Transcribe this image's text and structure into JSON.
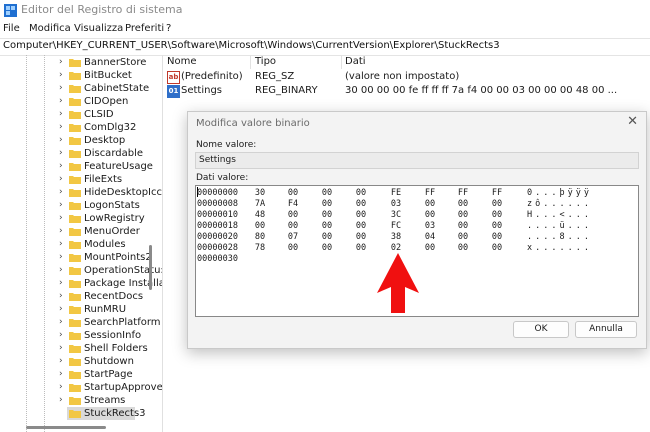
{
  "window": {
    "title": "Editor del Registro di sistema",
    "app_icon": "regedit-icon"
  },
  "menu": [
    "File",
    "Modifica",
    "Visualizza",
    "Preferiti",
    "?"
  ],
  "address": "Computer\\HKEY_CURRENT_USER\\Software\\Microsoft\\Windows\\CurrentVersion\\Explorer\\StuckRects3",
  "tree": {
    "items": [
      {
        "label": "BannerStore"
      },
      {
        "label": "BitBucket"
      },
      {
        "label": "CabinetState"
      },
      {
        "label": "CIDOpen"
      },
      {
        "label": "CLSID"
      },
      {
        "label": "ComDlg32"
      },
      {
        "label": "Desktop"
      },
      {
        "label": "Discardable"
      },
      {
        "label": "FeatureUsage"
      },
      {
        "label": "FileExts"
      },
      {
        "label": "HideDesktopIcc"
      },
      {
        "label": "LogonStats"
      },
      {
        "label": "LowRegistry"
      },
      {
        "label": "MenuOrder"
      },
      {
        "label": "Modules"
      },
      {
        "label": "MountPoints2"
      },
      {
        "label": "OperationStatu:"
      },
      {
        "label": "Package Installa"
      },
      {
        "label": "RecentDocs"
      },
      {
        "label": "RunMRU"
      },
      {
        "label": "SearchPlatform"
      },
      {
        "label": "SessionInfo"
      },
      {
        "label": "Shell Folders"
      },
      {
        "label": "Shutdown"
      },
      {
        "label": "StartPage"
      },
      {
        "label": "StartupApprove"
      },
      {
        "label": "Streams"
      },
      {
        "label": "StuckRects3"
      }
    ],
    "selected": "StuckRects3"
  },
  "list": {
    "headers": {
      "name": "Nome",
      "type": "Tipo",
      "data": "Dati"
    },
    "rows": [
      {
        "icon": "string-value-icon",
        "icon_text": "ab",
        "name": "(Predefinito)",
        "type": "REG_SZ",
        "data": "(valore non impostato)"
      },
      {
        "icon": "binary-value-icon",
        "icon_text": "01",
        "name": "Settings",
        "type": "REG_BINARY",
        "data": "30 00 00 00 fe ff ff ff 7a f4 00 00 03 00 00 00 48 00 ..."
      }
    ]
  },
  "dialog": {
    "title": "Modifica valore binario",
    "name_label": "Nome valore:",
    "name_value": "Settings",
    "data_label": "Dati valore:",
    "hex_rows": [
      {
        "offset": "00000000",
        "bytes": [
          "30",
          "00",
          "00",
          "00",
          "FE",
          "FF",
          "FF",
          "FF"
        ],
        "ascii": "0...þÿÿÿ"
      },
      {
        "offset": "00000008",
        "bytes": [
          "7A",
          "F4",
          "00",
          "00",
          "03",
          "00",
          "00",
          "00"
        ],
        "ascii": "zô......"
      },
      {
        "offset": "00000010",
        "bytes": [
          "48",
          "00",
          "00",
          "00",
          "3C",
          "00",
          "00",
          "00"
        ],
        "ascii": "H...<..."
      },
      {
        "offset": "00000018",
        "bytes": [
          "00",
          "00",
          "00",
          "00",
          "FC",
          "03",
          "00",
          "00"
        ],
        "ascii": "....ü..."
      },
      {
        "offset": "00000020",
        "bytes": [
          "80",
          "07",
          "00",
          "00",
          "38",
          "04",
          "00",
          "00"
        ],
        "ascii": "....8..."
      },
      {
        "offset": "00000028",
        "bytes": [
          "78",
          "00",
          "00",
          "00",
          "02",
          "00",
          "00",
          "00"
        ],
        "ascii": "x......."
      },
      {
        "offset": "00000030",
        "bytes": [],
        "ascii": ""
      }
    ],
    "ok_label": "OK",
    "cancel_label": "Annulla"
  },
  "colors": {
    "folder": "#f2c744",
    "arrow": "#f01010",
    "accent": "#0b62c4"
  }
}
